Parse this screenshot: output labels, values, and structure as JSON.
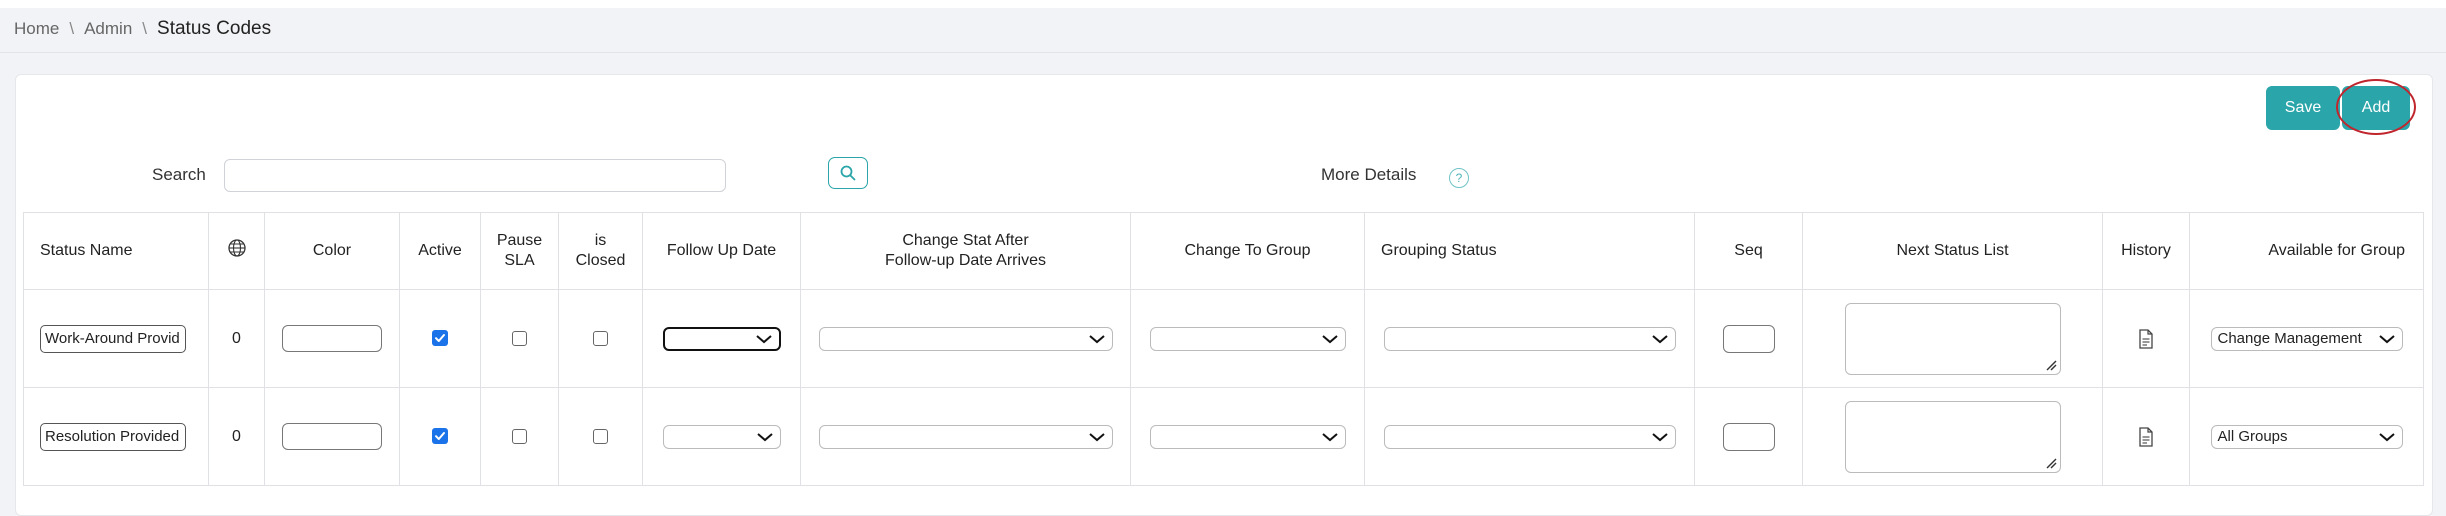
{
  "breadcrumb": {
    "items": [
      "Home",
      "Admin"
    ],
    "current": "Status Codes",
    "separator": "\\"
  },
  "toolbar": {
    "save_label": "Save",
    "add_label": "Add"
  },
  "search": {
    "label": "Search",
    "value": "",
    "more_details_label": "More Details",
    "help_symbol": "?"
  },
  "colors": {
    "accent": "#2aa5a9",
    "highlight_ring": "#c0262d",
    "checkbox_checked": "#1a73e8"
  },
  "table": {
    "headers": {
      "status_name": "Status Name",
      "globe_icon": "globe-icon",
      "color": "Color",
      "active": "Active",
      "pause_sla_line1": "Pause",
      "pause_sla_line2": "SLA",
      "is_closed_line1": "is",
      "is_closed_line2": "Closed",
      "follow_up_date": "Follow Up Date",
      "change_stat_line1": "Change Stat After",
      "change_stat_line2": "Follow-up Date Arrives",
      "change_to_group": "Change To Group",
      "grouping_status": "Grouping Status",
      "seq": "Seq",
      "next_status_list": "Next Status List",
      "history": "History",
      "available_for_group": "Available for Group"
    },
    "rows": [
      {
        "status_name": "Work-Around Provid",
        "translations": "0",
        "color": "",
        "active": true,
        "pause_sla": false,
        "is_closed": false,
        "follow_up_date": "",
        "change_stat_after": "",
        "change_to_group": "",
        "grouping_status": "",
        "seq": "",
        "next_status_list": "",
        "available_for_group": "Change Management"
      },
      {
        "status_name": "Resolution Provided",
        "translations": "0",
        "color": "",
        "active": true,
        "pause_sla": false,
        "is_closed": false,
        "follow_up_date": "",
        "change_stat_after": "",
        "change_to_group": "",
        "grouping_status": "",
        "seq": "",
        "next_status_list": "",
        "available_for_group": "All Groups"
      }
    ]
  }
}
